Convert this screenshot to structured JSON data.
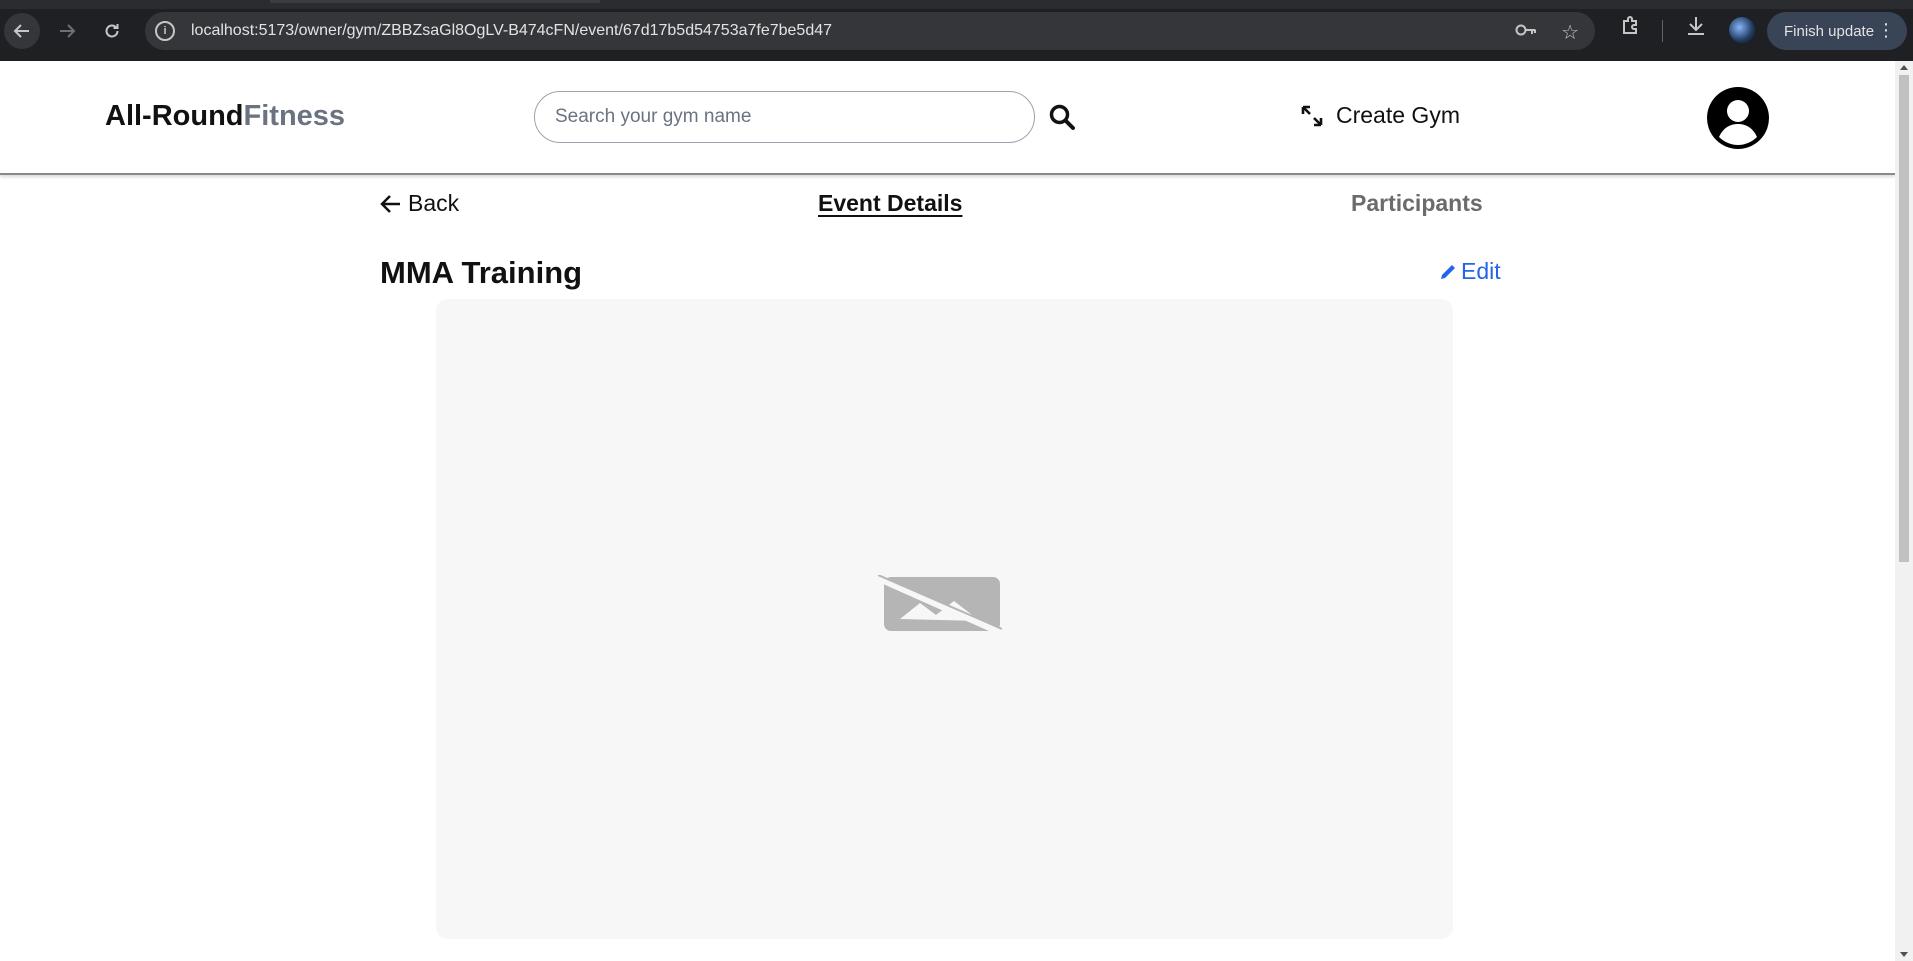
{
  "browser": {
    "url": "localhost:5173/owner/gym/ZBBZsaGl8OgLV-B474cFN/event/67d17b5d54753a7fe7be5d47",
    "finish_update_label": "Finish update"
  },
  "header": {
    "logo_primary": "All-Round",
    "logo_accent": "Fitness",
    "search_placeholder": "Search your gym name",
    "create_gym_label": "Create Gym"
  },
  "subnav": {
    "back_label": "Back",
    "tabs": [
      {
        "label": "Event Details",
        "active": true
      },
      {
        "label": "Participants",
        "active": false
      }
    ]
  },
  "event": {
    "title": "MMA Training",
    "edit_label": "Edit"
  },
  "icons": {
    "search": "search-icon",
    "create_gym": "expand-arrows-icon",
    "avatar": "user-circle-icon",
    "back": "arrow-left-icon",
    "edit": "pencil-icon",
    "image": "broken-image-icon"
  },
  "colors": {
    "accent_link": "#2563eb",
    "logo_accent": "#6b7280",
    "image_placeholder_bg": "#f7f7f7"
  }
}
